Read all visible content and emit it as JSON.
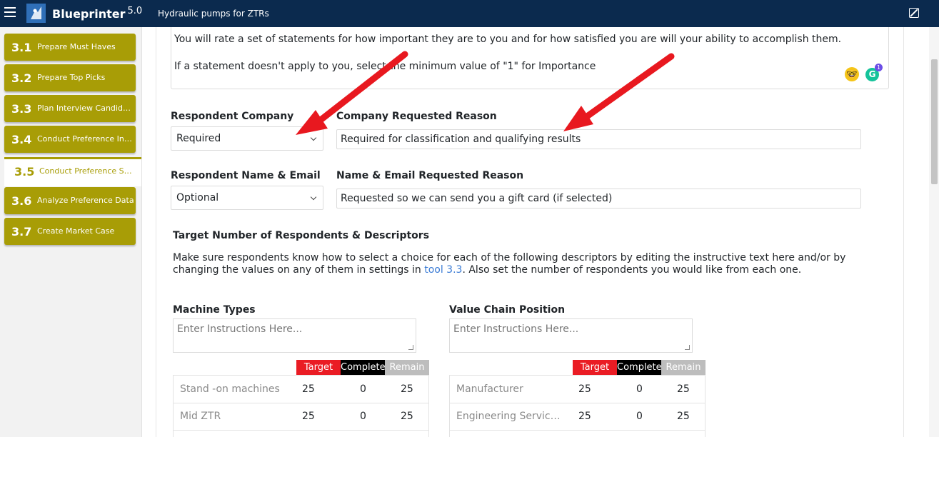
{
  "header": {
    "brand": "Blueprinter",
    "version": "5.0",
    "project_title": "Hydraulic pumps for ZTRs"
  },
  "sidebar": {
    "items": [
      {
        "num": "3.1",
        "label": "Prepare Must Haves"
      },
      {
        "num": "3.2",
        "label": "Prepare Top Picks"
      },
      {
        "num": "3.3",
        "label": "Plan Interview Candida..."
      },
      {
        "num": "3.4",
        "label": "Conduct Preference Int..."
      },
      {
        "num": "3.5",
        "label": "Conduct Preference Sur..."
      },
      {
        "num": "3.6",
        "label": "Analyze Preference Data"
      },
      {
        "num": "3.7",
        "label": "Create Market Case"
      }
    ],
    "active_index": 4
  },
  "intro": {
    "line1": "You will rate a set of statements for how important they are to you and for how satisfied you are will your ability to accomplish them.",
    "line2": "If a statement doesn't apply to you, select the minimum value of \"1\" for Importance",
    "grammarly_badge": "1"
  },
  "form": {
    "company_label": "Respondent Company",
    "company_value": "Required",
    "company_reason_label": "Company Requested Reason",
    "company_reason_value": "Required for classification and qualifying results",
    "name_label": "Respondent Name & Email",
    "name_value": "Optional",
    "name_reason_label": "Name & Email Requested Reason",
    "name_reason_value": "Requested so we can send you a gift card (if selected)"
  },
  "targets": {
    "title": "Target Number of Respondents & Descriptors",
    "text_before_link": "Make sure respondents know how to select a choice for each of the following descriptors by editing the instructive text here and/or by changing the values on any of them in settings in ",
    "link_text": "tool 3.3",
    "text_after_link": ". Also set the number of respondents you would like from each one."
  },
  "columns": {
    "target": "Target",
    "complete": "Complete",
    "remain": "Remain"
  },
  "descriptor_groups": [
    {
      "title": "Machine Types",
      "placeholder": "Enter Instructions Here...",
      "rows": [
        {
          "name": "Stand -on machines",
          "target": "25",
          "complete": "0",
          "remain": "25"
        },
        {
          "name": "Mid ZTR",
          "target": "25",
          "complete": "0",
          "remain": "25"
        }
      ]
    },
    {
      "title": "Value Chain Position",
      "placeholder": "Enter Instructions Here...",
      "rows": [
        {
          "name": "Manufacturer",
          "target": "25",
          "complete": "0",
          "remain": "25"
        },
        {
          "name": "Engineering Service Fi...",
          "target": "25",
          "complete": "0",
          "remain": "25"
        }
      ]
    }
  ],
  "colors": {
    "topbar": "#0b2a4e",
    "sidebar_item": "#a89d06",
    "target": "#ea1c24",
    "complete": "#000000",
    "remain": "#bdbdbd",
    "annotation_arrow": "#e8181f"
  }
}
